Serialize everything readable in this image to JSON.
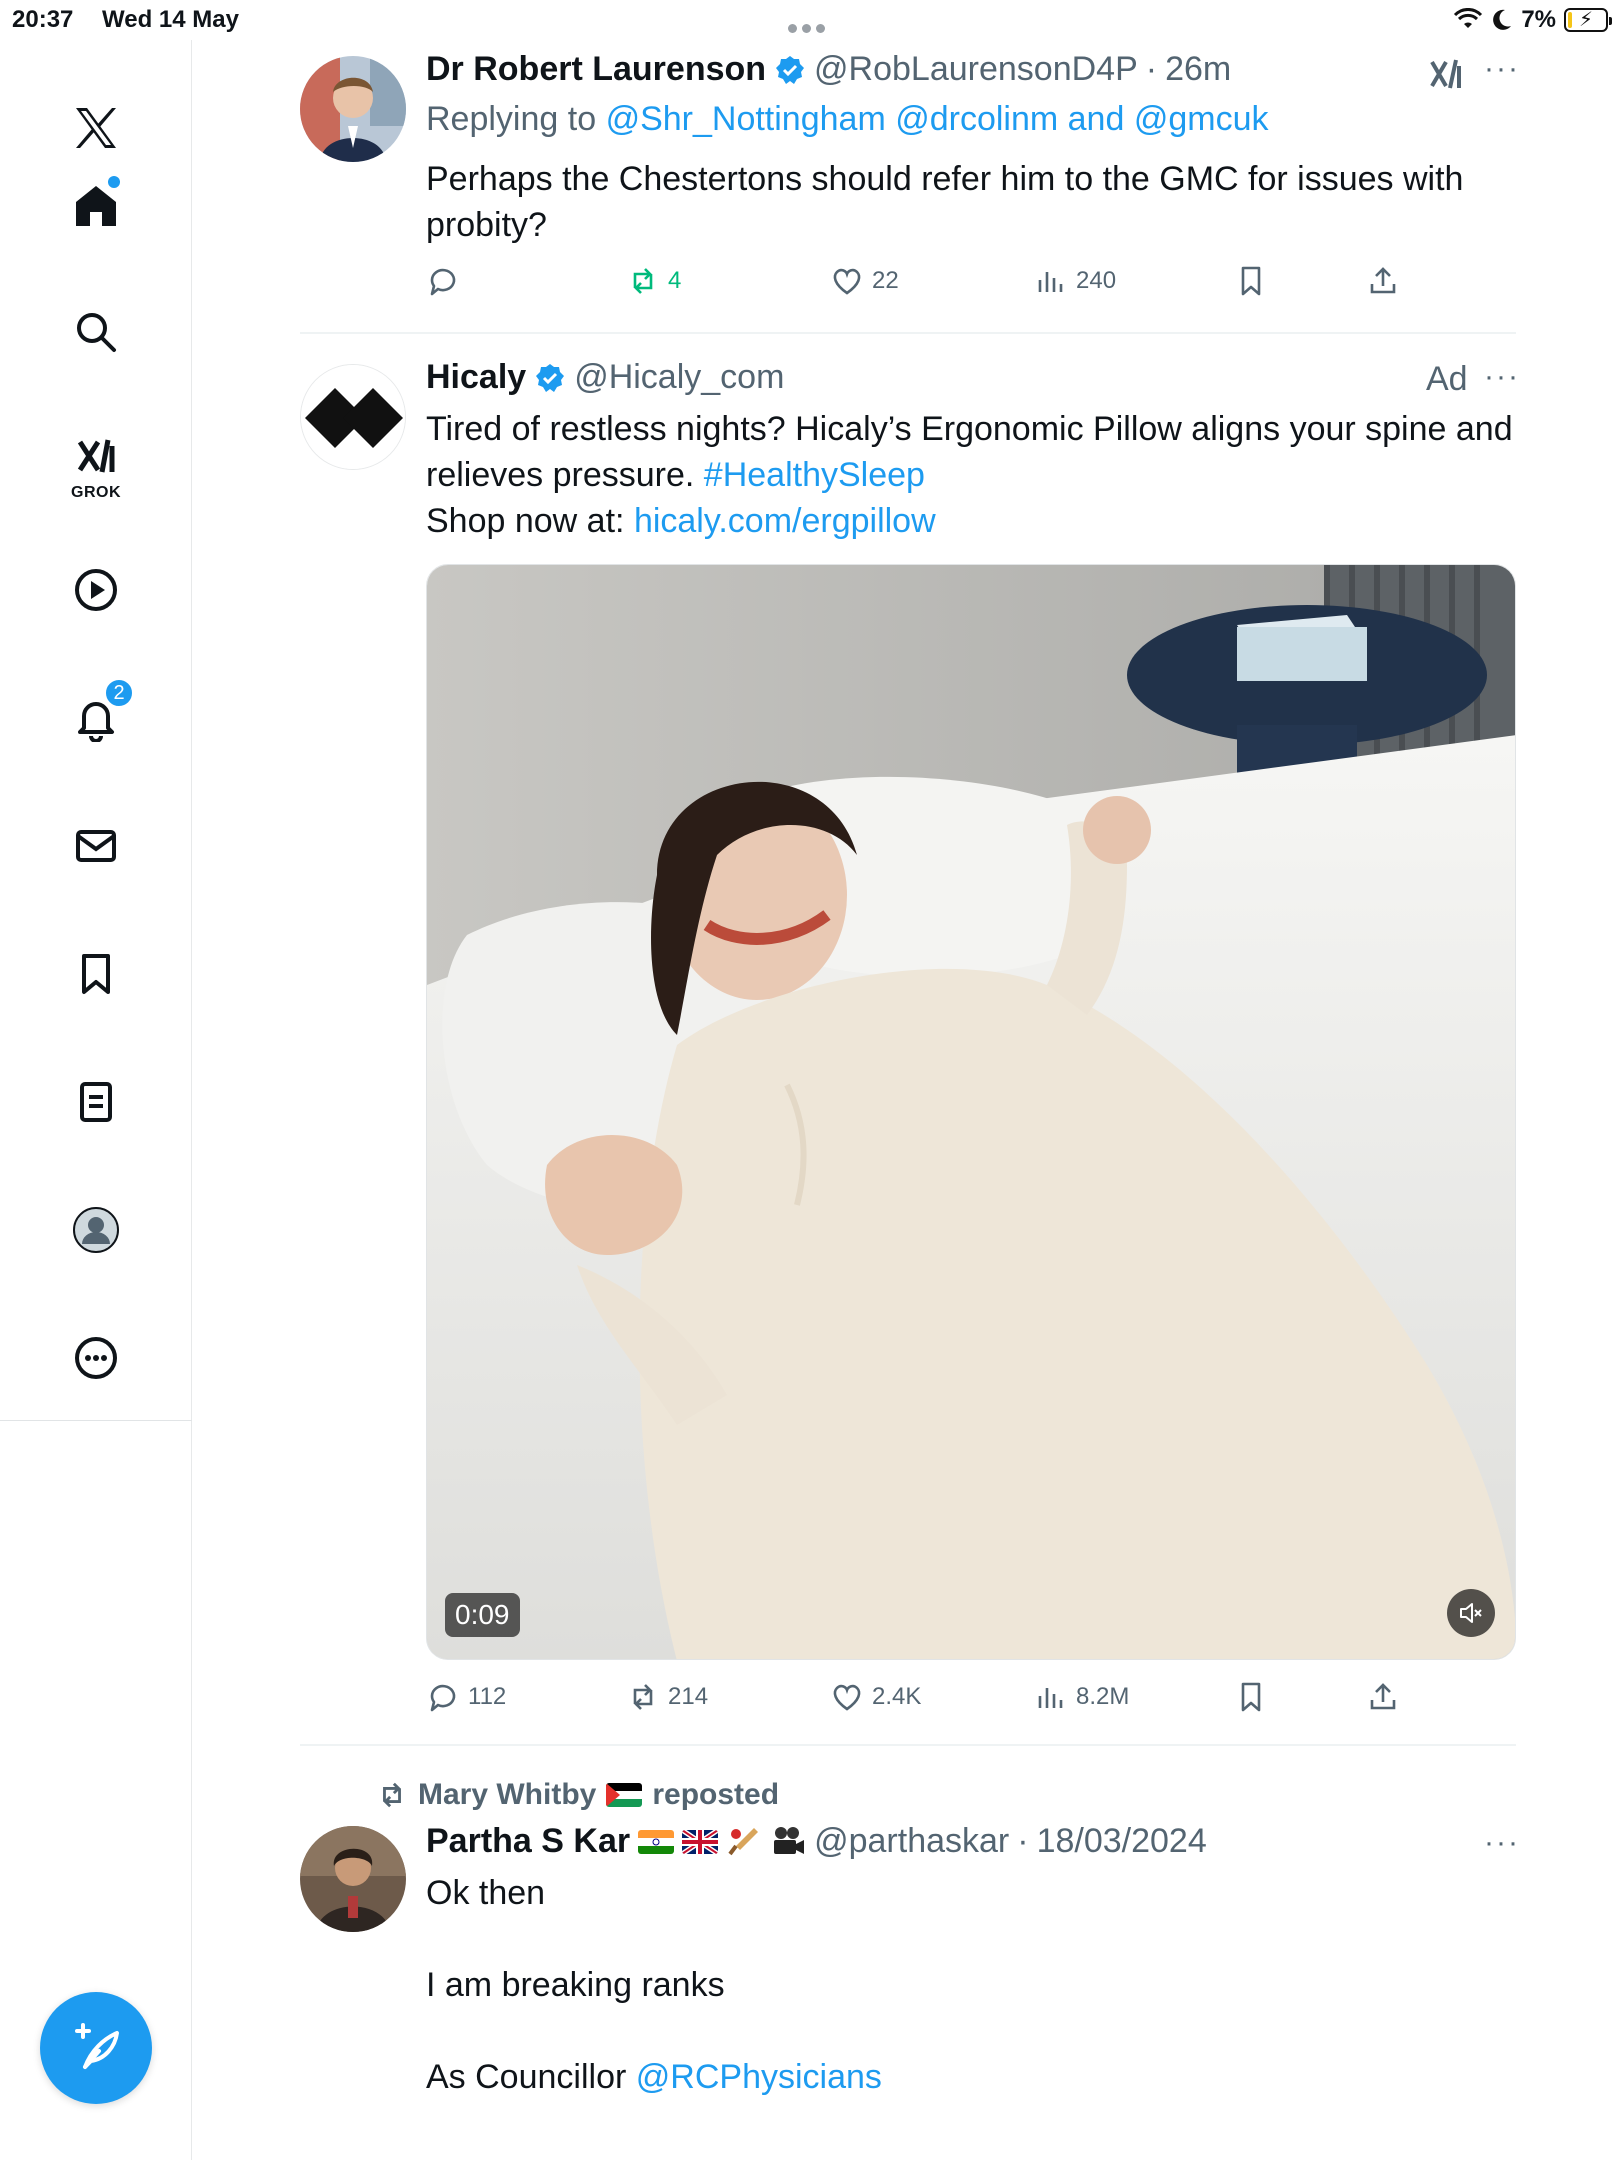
{
  "status_bar": {
    "time": "20:37",
    "date": "Wed 14 May",
    "battery_pct": "7%"
  },
  "sidebar": {
    "items": [
      {
        "name": "home",
        "label": "Home"
      },
      {
        "name": "explore",
        "label": "Search"
      },
      {
        "name": "grok",
        "label": "GROK"
      },
      {
        "name": "video",
        "label": "Video"
      },
      {
        "name": "notifications",
        "label": "Notifications",
        "badge": "2"
      },
      {
        "name": "messages",
        "label": "Messages"
      },
      {
        "name": "bookmarks",
        "label": "Bookmarks"
      },
      {
        "name": "lists",
        "label": "Lists"
      },
      {
        "name": "profile",
        "label": "Profile"
      },
      {
        "name": "more",
        "label": "More"
      }
    ]
  },
  "tweets": [
    {
      "name": "Dr Robert Laurenson",
      "handle": "@RobLaurensonD4P",
      "separator": "·",
      "time": "26m",
      "replying_prefix": "Replying to",
      "reply_mentions": "@Shr_Nottingham @drcolinm and @gmcuk",
      "text": "Perhaps the Chestertons should refer him to the GMC for issues with probity?",
      "stats": {
        "replies": "",
        "reposts": "4",
        "likes": "22",
        "views": "240"
      },
      "more": "···"
    },
    {
      "name": "Hicaly",
      "handle": "@Hicaly_com",
      "ad_label": "Ad",
      "text_line1": "Tired of restless nights? Hicaly’s Ergonomic Pillow aligns your spine and",
      "text_line2": "relieves pressure.",
      "hashtag": "#HealthySleep",
      "shop_prefix": "Shop now at:",
      "shop_link": "hicaly.com/ergpillow",
      "video_time": "0:09",
      "stats": {
        "replies": "112",
        "reposts": "214",
        "likes": "2.4K",
        "views": "8.2M"
      },
      "more": "···"
    },
    {
      "reposted_by": "Mary Whitby",
      "reposted_suffix": "reposted",
      "name": "Partha S Kar",
      "handle": "@parthaskar",
      "separator": "·",
      "time": "18/03/2024",
      "lines": [
        "Ok then",
        "I am breaking ranks",
        "As Councillor"
      ],
      "mention": "@RCPhysicians",
      "more": "···"
    }
  ],
  "colors": {
    "accent": "#1d9bf0",
    "muted": "#536471",
    "repost_green": "#00ba7c",
    "text": "#0f1419"
  }
}
